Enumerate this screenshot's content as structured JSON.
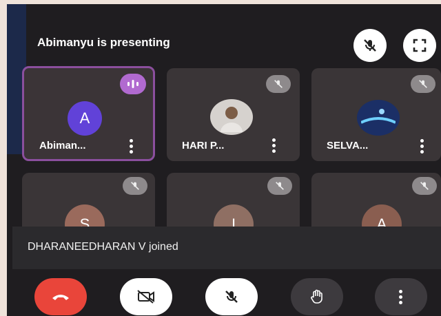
{
  "header": {
    "title": "Abimanyu is presenting"
  },
  "top_actions": [
    {
      "icon": "mic-off-icon"
    },
    {
      "icon": "fullscreen-icon"
    }
  ],
  "participants": [
    {
      "name": "Abiman...",
      "initial": "A",
      "avatar_color": "#6142d8",
      "active_speaker": true,
      "avatar_type": "letter"
    },
    {
      "name": "HARI P...",
      "initial": "",
      "avatar_color": "#d6d2ce",
      "active_speaker": false,
      "muted": true,
      "avatar_type": "photo"
    },
    {
      "name": "SELVA...",
      "initial": "",
      "avatar_color": "#1b2f66",
      "active_speaker": false,
      "muted": true,
      "avatar_type": "photo"
    },
    {
      "name": "",
      "initial": "S",
      "avatar_color": "#9a6a5c",
      "muted": true,
      "avatar_type": "letter"
    },
    {
      "name": "",
      "initial": "I",
      "avatar_color": "#8f6f63",
      "muted": true,
      "avatar_type": "letter"
    },
    {
      "name": "",
      "initial": "A",
      "avatar_color": "#8a5e50",
      "muted": true,
      "avatar_type": "letter"
    }
  ],
  "toast": {
    "message": "DHARANEEDHARAN V joined"
  },
  "controls": [
    {
      "icon": "end-call-icon",
      "color": "#e9453a"
    },
    {
      "icon": "camera-off-icon",
      "color": "#ffffff"
    },
    {
      "icon": "mic-off-icon",
      "color": "#ffffff"
    },
    {
      "icon": "raise-hand-icon",
      "color": "#3d3a3e"
    },
    {
      "icon": "more-options-icon",
      "color": "#3d3a3e"
    }
  ]
}
